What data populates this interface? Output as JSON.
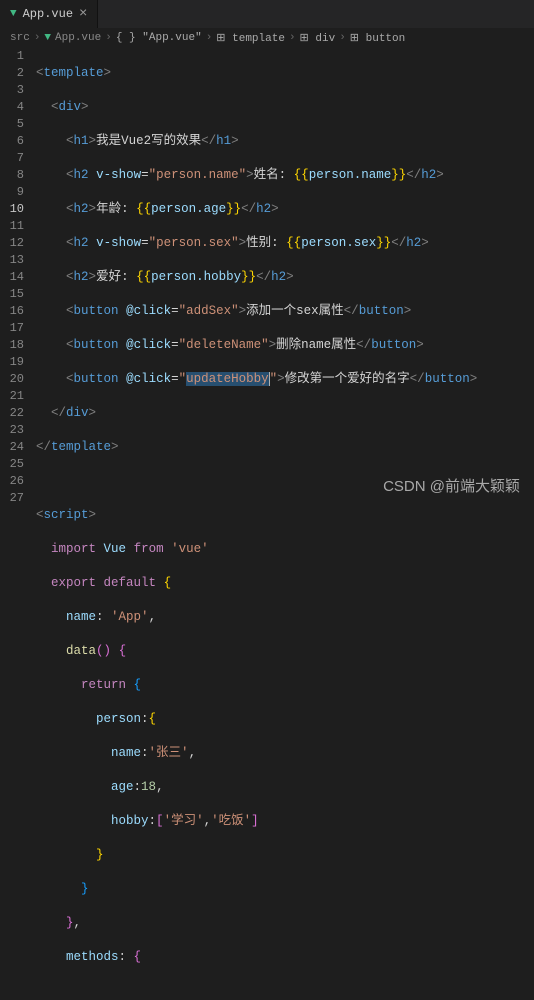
{
  "tabs": {
    "filename": "App.vue"
  },
  "breadcrumb": [
    "src",
    "App.vue",
    "{ } \"App.vue\"",
    "template",
    "div",
    "button"
  ],
  "lines": {
    "l1": {
      "tag": "template"
    },
    "l2": {
      "tag": "div"
    },
    "l3": {
      "tag": "h1",
      "txt": "我是Vue2写的效果"
    },
    "l4": {
      "tag": "h2",
      "dir": "v-show",
      "expr": "person.name",
      "label": "姓名: ",
      "bind": "person.name"
    },
    "l5": {
      "tag": "h2",
      "label": "年龄: ",
      "bind": "person.age"
    },
    "l6": {
      "tag": "h2",
      "dir": "v-show",
      "expr": "person.sex",
      "label": "性别: ",
      "bind": "person.sex"
    },
    "l7": {
      "tag": "h2",
      "label": "爱好: ",
      "bind": "person.hobby"
    },
    "l8": {
      "tag": "button",
      "evt": "@click",
      "handler": "addSex",
      "txt": "添加一个sex属性"
    },
    "l9": {
      "tag": "button",
      "evt": "@click",
      "handler": "deleteName",
      "txt": "删除name属性"
    },
    "l10": {
      "tag": "button",
      "evt": "@click",
      "handler": "updateHobby",
      "txt": "修改第一个爱好的名字"
    },
    "l11": {
      "close": "div"
    },
    "l12": {
      "close": "template"
    },
    "l14": {
      "tag": "script"
    },
    "l15": {
      "kw": "import",
      "ident": "Vue",
      "from": "from",
      "src": "'vue'"
    },
    "l16": {
      "kw": "export default"
    },
    "l17": {
      "prop": "name",
      "val": "'App'"
    },
    "l18": {
      "fn": "data"
    },
    "l19": {
      "kw": "return"
    },
    "l20": {
      "prop": "person"
    },
    "l21": {
      "prop": "name",
      "val": "'张三'"
    },
    "l22": {
      "prop": "age",
      "val": "18"
    },
    "l23": {
      "prop": "hobby",
      "arr": [
        "'学习'",
        "'吃饭'"
      ]
    },
    "l26": {},
    "l27": {
      "prop": "methods"
    }
  },
  "watermark": "CSDN @前端大颖颖"
}
